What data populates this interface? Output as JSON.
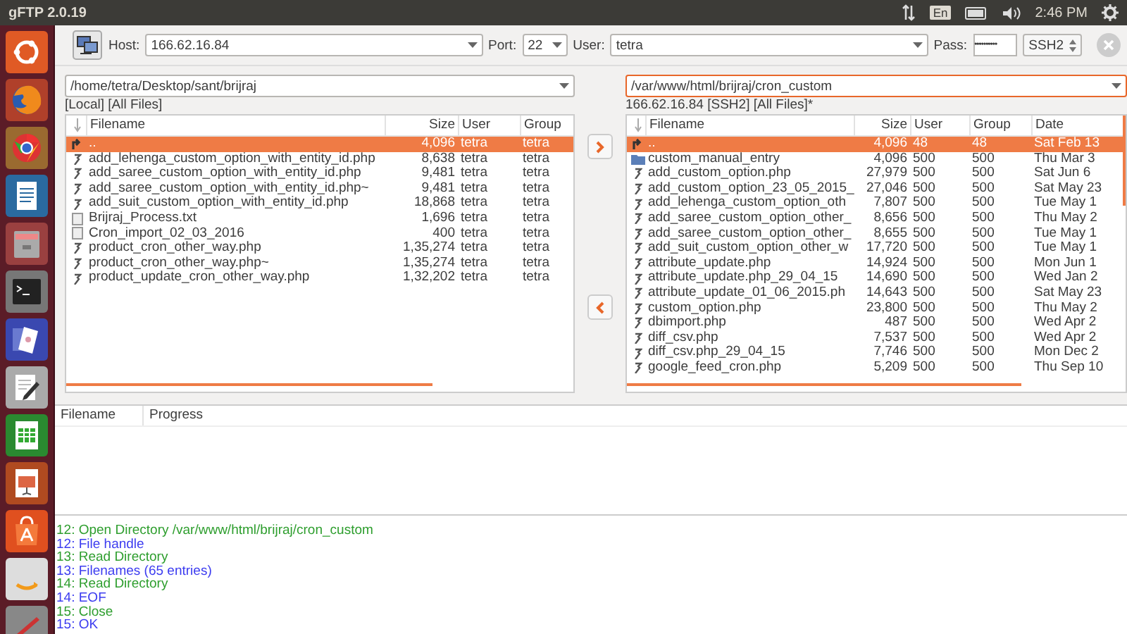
{
  "top_bar": {
    "title": "gFTP 2.0.19",
    "keyboard": "En",
    "time": "2:46 PM"
  },
  "toolbar": {
    "host_label": "Host:",
    "host": "166.62.16.84",
    "port_label": "Port:",
    "port": "22",
    "user_label": "User:",
    "user": "tetra",
    "pass_label": "Pass:",
    "pass": "••••••••••",
    "protocol": "SSH2"
  },
  "panes": [
    {
      "path": "/home/tetra/Desktop/sant/brijraj",
      "focused": false,
      "status": "[Local] [All Files]",
      "columns": [
        "Filename",
        "Size",
        "User",
        "Group"
      ],
      "rows": [
        {
          "kind": "parent",
          "selected": true,
          "cells": [
            "..",
            "4,096",
            "tetra",
            "tetra"
          ]
        },
        {
          "kind": "script",
          "selected": false,
          "cells": [
            "add_lehenga_custom_option_with_entity_id.php",
            "8,638",
            "tetra",
            "tetra"
          ]
        },
        {
          "kind": "script",
          "selected": false,
          "cells": [
            "add_saree_custom_option_with_entity_id.php",
            "9,481",
            "tetra",
            "tetra"
          ]
        },
        {
          "kind": "script",
          "selected": false,
          "cells": [
            "add_saree_custom_option_with_entity_id.php~",
            "9,481",
            "tetra",
            "tetra"
          ]
        },
        {
          "kind": "script",
          "selected": false,
          "cells": [
            "add_suit_custom_option_with_entity_id.php",
            "18,868",
            "tetra",
            "tetra"
          ]
        },
        {
          "kind": "text",
          "selected": false,
          "cells": [
            "Brijraj_Process.txt",
            "1,696",
            "tetra",
            "tetra"
          ]
        },
        {
          "kind": "text",
          "selected": false,
          "cells": [
            "Cron_import_02_03_2016",
            "400",
            "tetra",
            "tetra"
          ]
        },
        {
          "kind": "script",
          "selected": false,
          "cells": [
            "product_cron_other_way.php",
            "1,35,274",
            "tetra",
            "tetra"
          ]
        },
        {
          "kind": "script",
          "selected": false,
          "cells": [
            "product_cron_other_way.php~",
            "1,35,274",
            "tetra",
            "tetra"
          ]
        },
        {
          "kind": "script",
          "selected": false,
          "cells": [
            "product_update_cron_other_way.php",
            "1,32,202",
            "tetra",
            "tetra"
          ]
        }
      ]
    },
    {
      "path": "/var/www/html/brijraj/cron_custom",
      "focused": true,
      "status": "166.62.16.84 [SSH2] [All Files]*",
      "columns": [
        "Filename",
        "Size",
        "User",
        "Group",
        "Date"
      ],
      "rows": [
        {
          "kind": "parent",
          "selected": true,
          "cells": [
            "..",
            "4,096",
            "48",
            "48",
            "Sat Feb 13"
          ]
        },
        {
          "kind": "folder",
          "selected": false,
          "cells": [
            "custom_manual_entry",
            "4,096",
            "500",
            "500",
            "Thu Mar 3"
          ]
        },
        {
          "kind": "script",
          "selected": false,
          "cells": [
            "add_custom_option.php",
            "27,979",
            "500",
            "500",
            "Sat Jun 6"
          ]
        },
        {
          "kind": "script",
          "selected": false,
          "cells": [
            "add_custom_option_23_05_2015_",
            "27,046",
            "500",
            "500",
            "Sat May 23"
          ]
        },
        {
          "kind": "script",
          "selected": false,
          "cells": [
            "add_lehenga_custom_option_oth",
            "7,807",
            "500",
            "500",
            "Tue May 1"
          ]
        },
        {
          "kind": "script",
          "selected": false,
          "cells": [
            "add_saree_custom_option_other_",
            "8,656",
            "500",
            "500",
            "Thu May 2"
          ]
        },
        {
          "kind": "script",
          "selected": false,
          "cells": [
            "add_saree_custom_option_other_",
            "8,655",
            "500",
            "500",
            "Tue May 1"
          ]
        },
        {
          "kind": "script",
          "selected": false,
          "cells": [
            "add_suit_custom_option_other_w",
            "17,720",
            "500",
            "500",
            "Tue May 1"
          ]
        },
        {
          "kind": "script",
          "selected": false,
          "cells": [
            "attribute_update.php",
            "14,924",
            "500",
            "500",
            "Mon Jun 1"
          ]
        },
        {
          "kind": "script",
          "selected": false,
          "cells": [
            "attribute_update.php_29_04_15",
            "14,690",
            "500",
            "500",
            "Wed Jan 2"
          ]
        },
        {
          "kind": "script",
          "selected": false,
          "cells": [
            "attribute_update_01_06_2015.ph",
            "14,643",
            "500",
            "500",
            "Sat May 23"
          ]
        },
        {
          "kind": "script",
          "selected": false,
          "cells": [
            "custom_option.php",
            "23,800",
            "500",
            "500",
            "Thu May 2"
          ]
        },
        {
          "kind": "script",
          "selected": false,
          "cells": [
            "dbimport.php",
            "487",
            "500",
            "500",
            "Wed Apr 2"
          ]
        },
        {
          "kind": "script",
          "selected": false,
          "cells": [
            "diff_csv.php",
            "7,537",
            "500",
            "500",
            "Wed Apr 2"
          ]
        },
        {
          "kind": "script",
          "selected": false,
          "cells": [
            "diff_csv.php_29_04_15",
            "7,746",
            "500",
            "500",
            "Mon Dec 2"
          ]
        },
        {
          "kind": "script",
          "selected": false,
          "cells": [
            "google_feed_cron.php",
            "5,209",
            "500",
            "500",
            "Thu Sep 10"
          ]
        }
      ]
    }
  ],
  "transfers": {
    "columns": [
      "Filename",
      "Progress"
    ]
  },
  "log": [
    {
      "text": "12: Open Directory /var/www/html/brijraj/cron_custom",
      "color": "#2e9e2e"
    },
    {
      "text": "12: File handle",
      "color": "#3c3cf0"
    },
    {
      "text": "13: Read Directory",
      "color": "#2e9e2e"
    },
    {
      "text": "13: Filenames (65 entries)",
      "color": "#3c3cf0"
    },
    {
      "text": "14: Read Directory",
      "color": "#2e9e2e"
    },
    {
      "text": "14: EOF",
      "color": "#3c3cf0"
    },
    {
      "text": "15: Close",
      "color": "#2e9e2e"
    },
    {
      "text": "15: OK",
      "color": "#3c3cf0"
    }
  ]
}
